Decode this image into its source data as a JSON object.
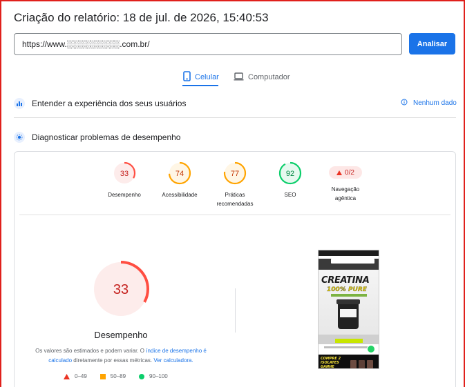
{
  "header": {
    "title": "Criação do relatório: 18 de jul. de 2026, 15:40:53"
  },
  "url_bar": {
    "value": "https://www.░░░░░░░░░.com.br/",
    "button_label": "Analisar"
  },
  "tabs": [
    {
      "label": "Celular",
      "icon": "smartphone-icon",
      "active": true
    },
    {
      "label": "Computador",
      "icon": "desktop-icon",
      "active": false
    }
  ],
  "sections": {
    "experience": {
      "label": "Entender a experiência dos seus usuários",
      "icon": "users-icon",
      "status": "Nenhum dado"
    },
    "diagnose": {
      "label": "Diagnosticar problemas de desempenho",
      "icon": "diagnose-icon"
    }
  },
  "scores": [
    {
      "value": "33",
      "label": "Desempenho",
      "color": "#ff4e42",
      "fraction": 0.33
    },
    {
      "value": "74",
      "label": "Acessibilidade",
      "color": "#ffa400",
      "fraction": 0.74
    },
    {
      "value": "77",
      "label": "Práticas recomendadas",
      "color": "#ffa400",
      "fraction": 0.77
    },
    {
      "value": "92",
      "label": "SEO",
      "color": "#0cce6b",
      "fraction": 0.92
    }
  ],
  "agentic": {
    "value": "0/2",
    "label": "Navegação agêntica"
  },
  "main_score": {
    "value": "33",
    "label": "Desempenho",
    "fraction": 0.33
  },
  "info": {
    "text1": "Os valores são estimados e podem variar. O ",
    "link1": "índice de desempenho é calculado",
    "text2": " diretamente por essas métricas. ",
    "link2": "Ver calculadora."
  },
  "legend": [
    {
      "range": "0–49",
      "color": "#ff4e42",
      "shape": "triangle"
    },
    {
      "range": "50–89",
      "color": "#ffa400",
      "shape": "square"
    },
    {
      "range": "90–100",
      "color": "#0cce6b",
      "shape": "circle"
    }
  ],
  "screenshot": {
    "headline": "CREATINA",
    "subheadline": "100% PURE",
    "promo": "COMPRE 2\nISOLATES\nGANHE"
  }
}
